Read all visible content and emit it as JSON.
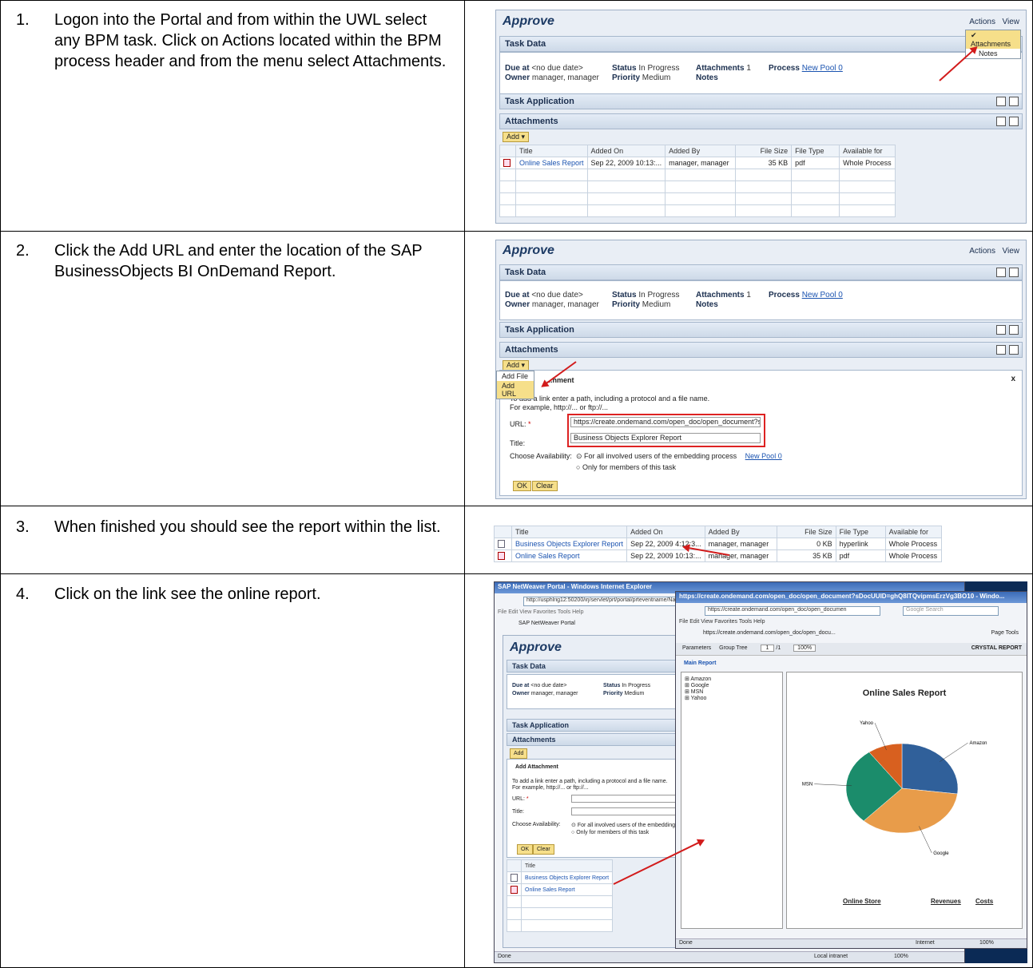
{
  "steps": [
    {
      "num": "1.",
      "text": "Logon into the Portal and from within the UWL select any BPM task.  Click on Actions located within the BPM process header and from the menu select Attachments."
    },
    {
      "num": "2.",
      "text": "Click the Add URL and enter the location of the SAP BusinessObjects BI OnDemand Report."
    },
    {
      "num": "3.",
      "text": "When finished you should see the report within the list."
    },
    {
      "num": "4.",
      "text": "Click on the link see the online report."
    }
  ],
  "sap": {
    "title": "Approve",
    "actions": "Actions",
    "view": "View",
    "menu_attachments": "Attachments",
    "menu_notes": "Notes",
    "task_data": "Task Data",
    "due_lbl": "Due at",
    "due_val": "<no due date>",
    "owner_lbl": "Owner",
    "owner_val": "manager, manager",
    "status_lbl": "Status",
    "status_val": "In Progress",
    "priority_lbl": "Priority",
    "priority_val": "Medium",
    "attach_lbl": "Attachments",
    "attach_val": "1",
    "notes_lbl": "Notes",
    "process_lbl": "Process",
    "process_val": "New Pool 0",
    "task_app": "Task Application",
    "attachments": "Attachments",
    "add": "Add",
    "cols": {
      "title": "Title",
      "added_on": "Added On",
      "added_by": "Added By",
      "size": "File Size",
      "type": "File Type",
      "avail": "Available for"
    },
    "row_online": {
      "title": "Online Sales Report",
      "added_on": "Sep 22, 2009 10:13:...",
      "added_by": "manager, manager",
      "size": "35 KB",
      "type": "pdf",
      "avail": "Whole Process"
    },
    "row_bo": {
      "title": "Business Objects Explorer Report",
      "added_on": "Sep 22, 2009 4:12:3...",
      "added_by": "manager, manager",
      "size": "0 KB",
      "type": "hyperlink",
      "avail": "Whole Process"
    },
    "add_file": "Add File",
    "add_url": "Add URL",
    "add_attachment": "Add Attachment",
    "add_attachment_cut": "...hment",
    "hint1": "To add a link enter a path, including a protocol and a file name.",
    "hint2": "For example, http://... or ftp://...",
    "url_lbl": "URL:",
    "url_val": "https://create.ondemand.com/open_doc/open_document?sDoc",
    "title_lbl": "Title:",
    "title_val": "Business Objects Explorer Report",
    "avail_lbl": "Choose Availability:",
    "opt1": "For all involved users of the embedding process",
    "opt2": "Only for members of this task",
    "ok": "OK",
    "clear": "Clear",
    "close": "x"
  },
  "ie": {
    "title": "SAP NetWeaver Portal - Windows Internet Explorer",
    "addr": "http://usphlrig12:50200/irj/servlet/prt/portal/prteventname/Navigate/prtroot/pcd!3aportal_content!...",
    "search": "Google Search",
    "menu": "File  Edit  View  Favorites  Tools  Help",
    "tab": "SAP NetWeaver Portal",
    "status_done": "Done",
    "local": "Local intranet",
    "zoom": "100%",
    "win2_title": "https://create.ondemand.com/open_doc/open_document?sDocUUID=ghQ8ITQvipmsErzVg3BO10 - Windo...",
    "win2_addr": "https://create.ondemand.com/open_doc/open_documen",
    "win2_tab": "https://create.ondemand.com/open_doc/open_docu...",
    "page_tools": "Page   Tools",
    "parameters": "Parameters",
    "group_tree": "Group Tree",
    "page_num": "1",
    "page_of": "/1",
    "crystal": "CRYSTAL REPORT",
    "main_report": "Main Report",
    "tree": [
      "Amazon",
      "Google",
      "MSN",
      "Yahoo"
    ],
    "report_title": "Online Sales Report",
    "online_store": "Online Store",
    "revenues": "Revenues",
    "costs": "Costs",
    "internet": "Internet"
  },
  "chart_data": {
    "type": "pie",
    "title": "Online Sales Report",
    "categories": [
      "Amazon",
      "Google",
      "MSN",
      "Yahoo"
    ],
    "values": [
      27,
      35,
      28,
      10
    ],
    "colors": [
      "#30609a",
      "#e89c4a",
      "#1b8c6b",
      "#d8601f"
    ]
  }
}
